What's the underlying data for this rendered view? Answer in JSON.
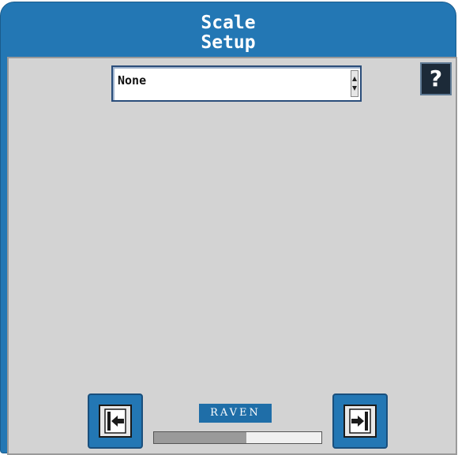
{
  "header": {
    "title_line1": "Scale",
    "title_line2": "Setup"
  },
  "scale_select": {
    "value": "None"
  },
  "help_button": {
    "label": "?"
  },
  "navigation": {
    "back_icon": "back-arrow-icon",
    "next_icon": "next-arrow-icon"
  },
  "logo": {
    "text": "RAVEN"
  },
  "progress": {
    "fraction": 0.55
  },
  "colors": {
    "accent": "#2377b4",
    "panel": "#d3d3d3"
  }
}
